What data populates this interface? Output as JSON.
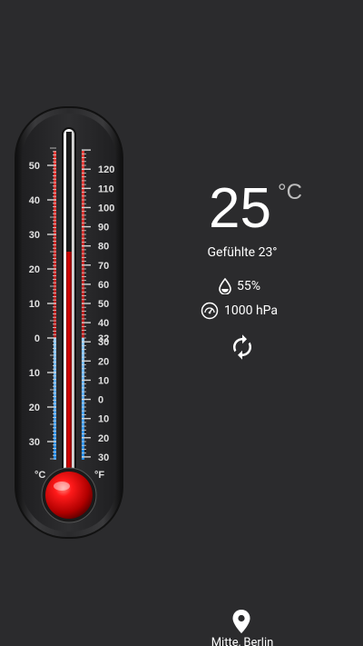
{
  "weather": {
    "temperature": "25",
    "temperature_unit": "°C",
    "feels_like": "Gefühlte 23°",
    "humidity": "55%",
    "pressure": "1000 hPa",
    "location": "Mitte, Berlin"
  },
  "thermometer": {
    "celsius_unit": "°C",
    "fahrenheit_unit": "°F",
    "current_celsius": 25,
    "celsius_scale": {
      "min": -35,
      "max": 55,
      "labels": [
        "50",
        "40",
        "30",
        "20",
        "10",
        "0",
        "10",
        "20",
        "30"
      ],
      "label_values": [
        50,
        40,
        30,
        20,
        10,
        0,
        -10,
        -20,
        -30
      ]
    },
    "fahrenheit_scale": {
      "labels": [
        "120",
        "110",
        "100",
        "90",
        "80",
        "70",
        "60",
        "50",
        "40",
        "32",
        "30",
        "20",
        "10",
        "0",
        "10",
        "20",
        "30"
      ],
      "label_values": [
        120,
        110,
        100,
        90,
        80,
        70,
        60,
        50,
        40,
        32,
        30,
        20,
        10,
        0,
        -10,
        -20,
        -30
      ]
    }
  },
  "colors": {
    "background": "#2b2b2d",
    "mercury": "#d50000",
    "warm_scale": "#e53935",
    "cold_scale": "#42a5f5",
    "text_secondary": "#bdbdbd"
  },
  "icons": {
    "humidity": "water-drop-icon",
    "pressure": "gauge-icon",
    "refresh": "refresh-icon",
    "location": "location-pin-icon"
  }
}
